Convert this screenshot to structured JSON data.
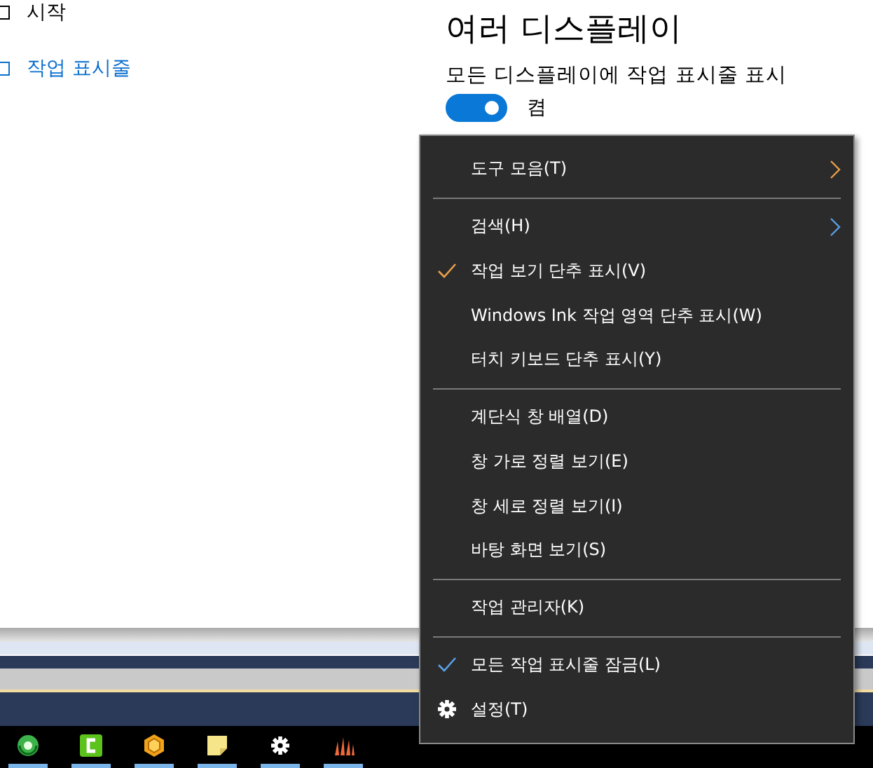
{
  "nav": [
    {
      "label": "시작",
      "selected": false
    },
    {
      "label": "작업 표시줄",
      "selected": true
    }
  ],
  "section": {
    "title": "여러 디스플레이",
    "setting_label": "모든 디스플레이에 작업 표시줄 표시",
    "toggle": {
      "on": true,
      "label": "켬"
    }
  },
  "context_menu": [
    {
      "kind": "submenu",
      "label": "도구 모음(T)"
    },
    {
      "kind": "separator"
    },
    {
      "kind": "submenu",
      "label": "검색(H)"
    },
    {
      "kind": "check",
      "label": "작업 보기 단추 표시(V)",
      "checked": true
    },
    {
      "kind": "check",
      "label": "Windows Ink 작업 영역 단추 표시(W)",
      "checked": false
    },
    {
      "kind": "check",
      "label": "터치 키보드 단추 표시(Y)",
      "checked": false
    },
    {
      "kind": "separator"
    },
    {
      "kind": "plain",
      "label": "계단식 창 배열(D)"
    },
    {
      "kind": "plain",
      "label": "창 가로 정렬 보기(E)"
    },
    {
      "kind": "plain",
      "label": "창 세로 정렬 보기(I)"
    },
    {
      "kind": "plain",
      "label": "바탕 화면 보기(S)"
    },
    {
      "kind": "separator"
    },
    {
      "kind": "plain",
      "label": "작업 관리자(K)"
    },
    {
      "kind": "separator"
    },
    {
      "kind": "check",
      "label": "모든 작업 표시줄 잠금(L)",
      "checked": true
    },
    {
      "kind": "settings",
      "label": "설정(T)"
    }
  ],
  "taskbar": {
    "apps": [
      {
        "kind": "globe"
      },
      {
        "kind": "c"
      },
      {
        "kind": "box"
      },
      {
        "kind": "note"
      },
      {
        "kind": "gear"
      },
      {
        "kind": "flame"
      }
    ]
  }
}
